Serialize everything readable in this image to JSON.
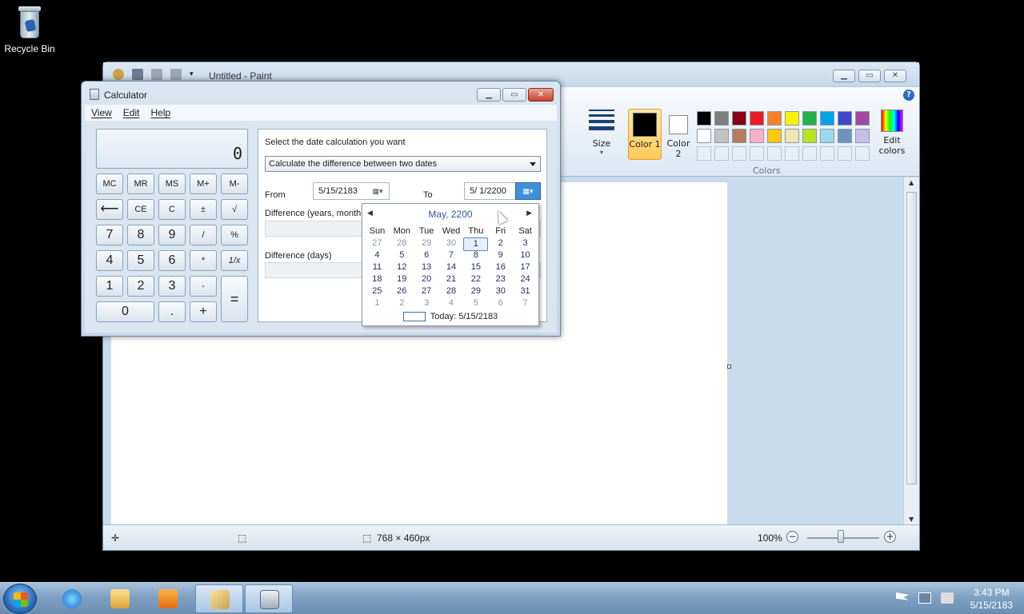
{
  "desktop": {
    "recycle_bin_label": "Recycle Bin"
  },
  "paint": {
    "title": "Untitled - Paint",
    "size_label": "Size",
    "color1_label": "Color 1",
    "color2_label": "Color 2",
    "edit_colors_label": "Edit colors",
    "colors_group_label": "Colors",
    "palette_row1": [
      "#000000",
      "#7f7f7f",
      "#880015",
      "#ed1c24",
      "#ff7f27",
      "#fff200",
      "#22b14c",
      "#00a2e8",
      "#3f48cc",
      "#a349a4"
    ],
    "palette_row2": [
      "#ffffff",
      "#c3c3c3",
      "#b97a57",
      "#ffaec9",
      "#ffc90e",
      "#efe4b0",
      "#b5e61d",
      "#99d9ea",
      "#7092be",
      "#c8bfe7"
    ],
    "status_size": "768 × 460px",
    "zoom": "100%"
  },
  "calculator": {
    "title": "Calculator",
    "menu": [
      "View",
      "Edit",
      "Help"
    ],
    "display": "0",
    "keys": {
      "mc": "MC",
      "mr": "MR",
      "ms": "MS",
      "mplus": "M+",
      "mminus": "M-",
      "back": "⟵",
      "ce": "CE",
      "c": "C",
      "pm": "±",
      "sqrt": "√",
      "k7": "7",
      "k8": "8",
      "k9": "9",
      "div": "/",
      "pct": "%",
      "k4": "4",
      "k5": "5",
      "k6": "6",
      "mul": "*",
      "inv": "1/x",
      "k1": "1",
      "k2": "2",
      "k3": "3",
      "sub": "-",
      "eq": "=",
      "k0": "0",
      "dot": ".",
      "add": "+"
    },
    "date": {
      "prompt": "Select the date calculation you want",
      "mode": "Calculate the difference between two dates",
      "from_label": "From",
      "from_value": "5/15/2183",
      "to_label": "To",
      "to_value": "5/ 1/2200",
      "diff_label": "Difference (years, month",
      "diff_days_label": "Difference (days)"
    },
    "calendar": {
      "month_label": "May, 2200",
      "weekdays": [
        "Sun",
        "Mon",
        "Tue",
        "Wed",
        "Thu",
        "Fri",
        "Sat"
      ],
      "weeks": [
        [
          "27",
          "28",
          "29",
          "30",
          "1",
          "2",
          "3"
        ],
        [
          "4",
          "5",
          "6",
          "7",
          "8",
          "9",
          "10"
        ],
        [
          "11",
          "12",
          "13",
          "14",
          "15",
          "16",
          "17"
        ],
        [
          "18",
          "19",
          "20",
          "21",
          "22",
          "23",
          "24"
        ],
        [
          "25",
          "26",
          "27",
          "28",
          "29",
          "30",
          "31"
        ],
        [
          "1",
          "2",
          "3",
          "4",
          "5",
          "6",
          "7"
        ]
      ],
      "today_label": "Today: 5/15/2183"
    }
  },
  "taskbar": {
    "time": "3:43 PM",
    "date": "5/15/2183"
  }
}
